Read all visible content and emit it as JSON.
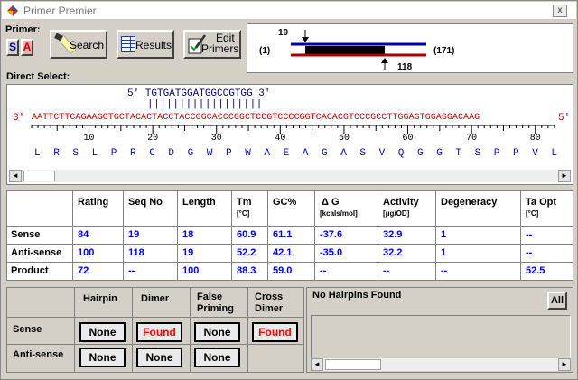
{
  "window": {
    "title": "Primer Premier",
    "close_label": "x"
  },
  "primer": {
    "label": "Primer:",
    "sense_btn": "S",
    "antisense_btn": "A",
    "search_label": "Search",
    "results_label": "Results",
    "edit_label_1": "Edit",
    "edit_label_2": "Primers"
  },
  "map": {
    "left_pos": "19",
    "right_pos": "118",
    "range_start": "(1)",
    "range_end": "(171)"
  },
  "direct_select_label": "Direct Select:",
  "sequence": {
    "primer_line": "5' TGTGATGGATGGCCGTGG 3'",
    "match_bars": "||||||||||||||||||",
    "prefix_3": "3'",
    "main_seq": "AATTCTTCAGAAGGTGCTACACTACCTACCGGCACCCGGCTCCGTCCCCGGTCACACGTCCCGCCTTGGAGTGGAGGACAAG",
    "suffix_5": "5'",
    "ruler_labels": [
      "10",
      "20",
      "30",
      "40",
      "50",
      "60",
      "70",
      "80"
    ],
    "amino_acids": [
      "L",
      "R",
      "S",
      "L",
      "P",
      "R",
      "C",
      "D",
      "G",
      "W",
      "P",
      "W",
      "A",
      "E",
      "A",
      "G",
      "A",
      "S",
      "V",
      "Q",
      "G",
      "G",
      "T",
      "S",
      "P",
      "P",
      "V",
      "L"
    ]
  },
  "table": {
    "headers": [
      "Rating",
      "Seq No",
      "Length",
      "Tm",
      "GC%",
      "Δ G",
      "Activity",
      "Degeneracy",
      "Ta Opt"
    ],
    "subheaders": {
      "tm": "[°C]",
      "dg": "[kcals/mol]",
      "activity": "[μg/OD]",
      "taopt": "[°C]"
    },
    "rows": [
      {
        "label": "Sense",
        "values": [
          "84",
          "19",
          "18",
          "60.9",
          "61.1",
          "-37.6",
          "32.9",
          "1",
          "--"
        ]
      },
      {
        "label": "Anti-sense",
        "values": [
          "100",
          "118",
          "19",
          "52.2",
          "42.1",
          "-35.0",
          "32.2",
          "1",
          "--"
        ]
      },
      {
        "label": "Product",
        "values": [
          "72",
          "--",
          "100",
          "88.3",
          "59.0",
          "--",
          "--",
          "--",
          "52.5"
        ]
      }
    ]
  },
  "checks": {
    "headers": [
      "Hairpin",
      "Dimer",
      "False Priming",
      "Cross Dimer"
    ],
    "header_line1": [
      "Hairpin",
      "Dimer",
      "False",
      "Cross"
    ],
    "header_line2": [
      "",
      "",
      "Priming",
      "Dimer"
    ],
    "sense_label": "Sense",
    "antisense_label": "Anti-sense",
    "sense": [
      "None",
      "Found",
      "None",
      "Found"
    ],
    "antisense": [
      "None",
      "None",
      "None"
    ]
  },
  "hairpin_panel": {
    "message": "No Hairpins Found",
    "all_label": "All"
  },
  "colors": {
    "accent_blue": "#0000ff",
    "found_red": "#ff0000",
    "sequence_red": "#cc0000",
    "primer_navy": "#000080"
  }
}
